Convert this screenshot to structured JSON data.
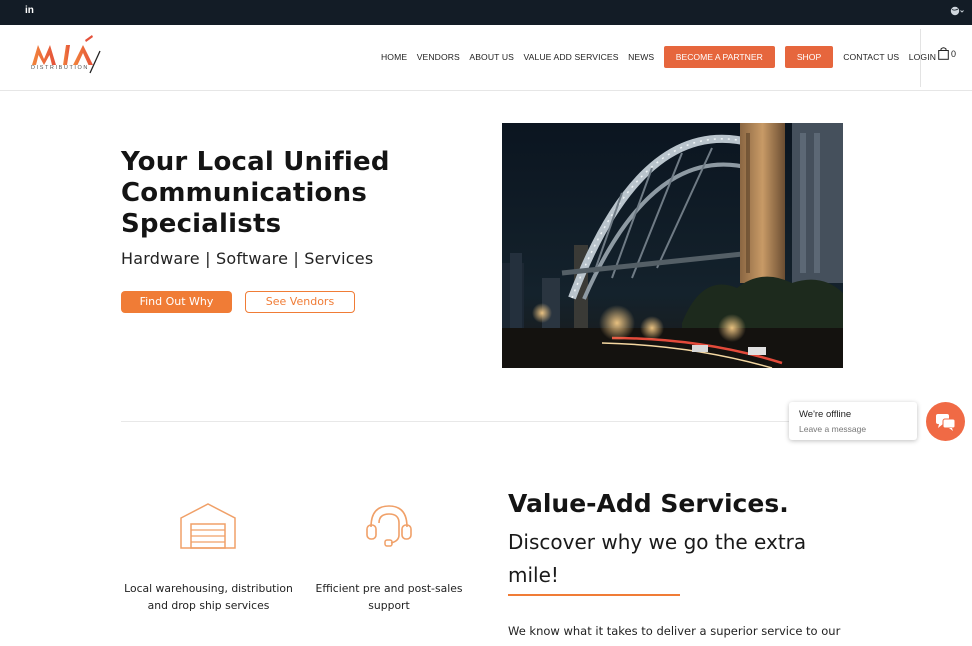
{
  "topbar": {
    "social_icon": "linkedin-icon",
    "social_label": "in",
    "language_icon": "globe-icon"
  },
  "header": {
    "logo_icon": "mia-distribution-logo",
    "logo_tagline": "DISTRIBUTION",
    "nav": {
      "home": "HOME",
      "vendors": "VENDORS",
      "about": "ABOUT US",
      "value_add": "VALUE ADD SERVICES",
      "news": "NEWS",
      "become_partner": "BECOME A PARTNER",
      "shop": "SHOP",
      "contact": "CONTACT US",
      "login": "LOGIN"
    },
    "cart_icon": "shopping-bag-icon",
    "cart_count": "0"
  },
  "hero": {
    "title": "Your Local Unified Communications Specialists",
    "subtitle": "Hardware | Software | Services",
    "primary_button": "Find Out Why",
    "secondary_button": "See Vendors",
    "image": "sydney-harbour-bridge-night-photo"
  },
  "chat": {
    "status": "We're offline",
    "prompt": "Leave a message",
    "icon": "chat-bubbles-icon"
  },
  "features": [
    {
      "icon": "warehouse-icon",
      "text": "Local warehousing, distribution and drop ship services"
    },
    {
      "icon": "headset-icon",
      "text": "Efficient pre and post-sales support"
    }
  ],
  "value_add": {
    "title": "Value-Add Services.",
    "subtitle": "Discover why we go the extra mile!",
    "body": "We know what it takes to deliver a superior service to our"
  },
  "colors": {
    "accent": "#f07c36",
    "partner_button": "#e6663d",
    "topbar": "#131c26",
    "chat": "#f06a45"
  }
}
